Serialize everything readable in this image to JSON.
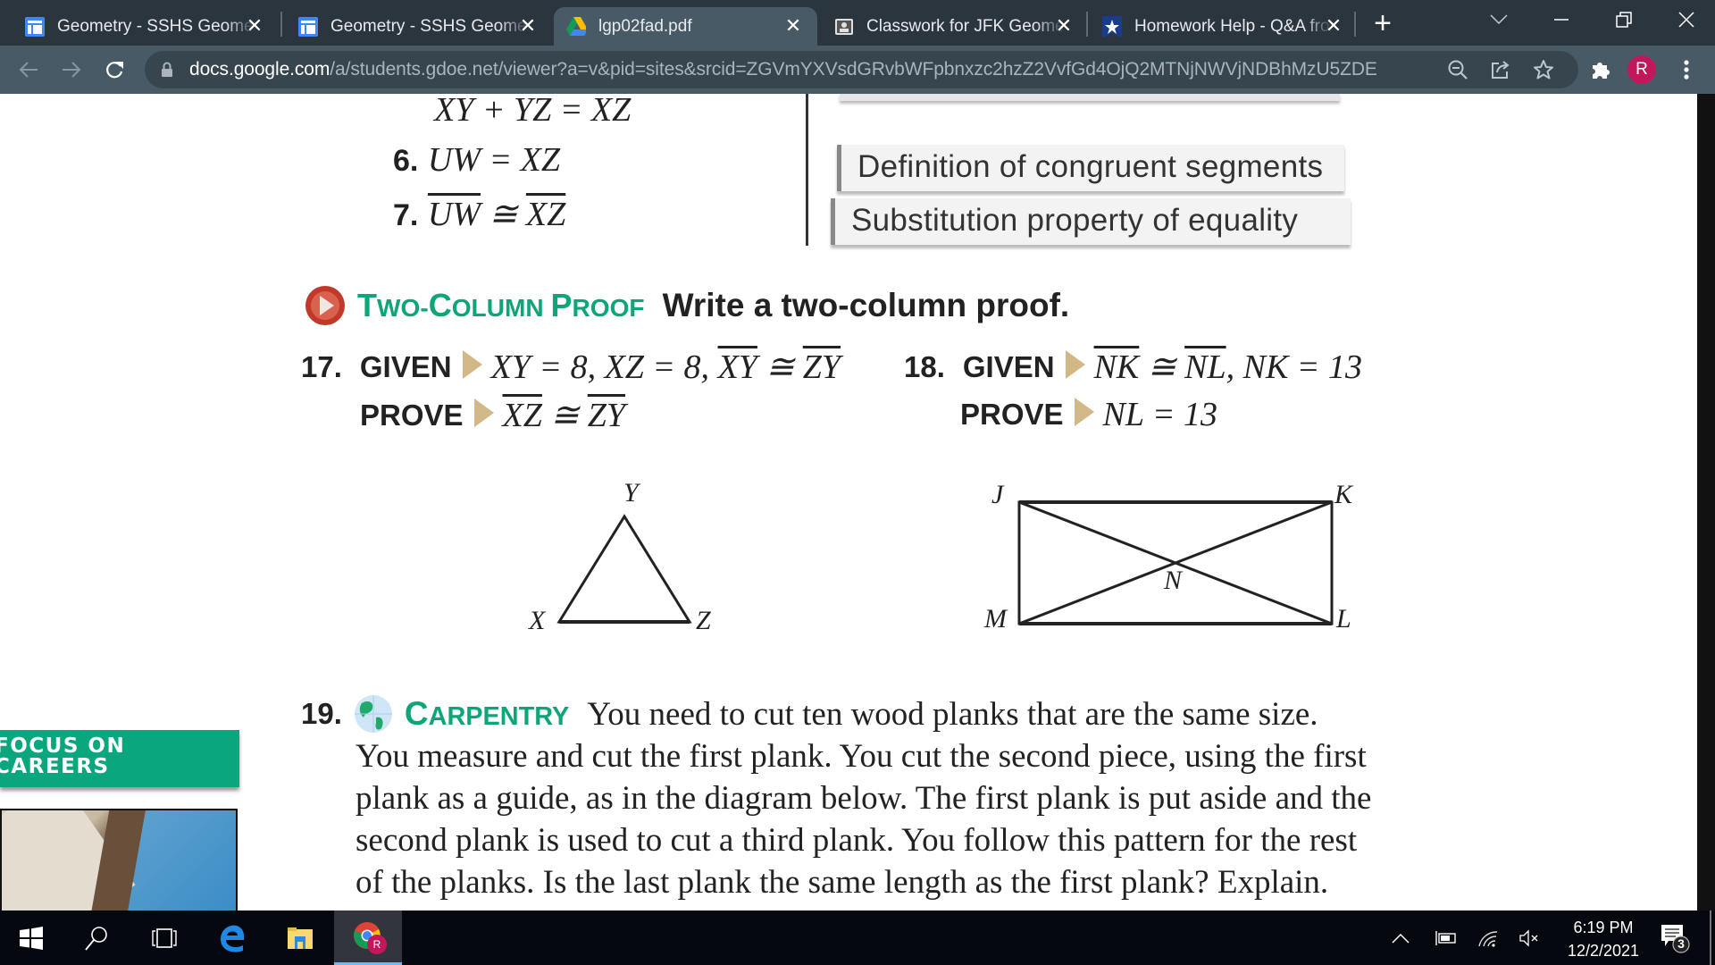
{
  "browser": {
    "tabs": [
      {
        "title": "Geometry - SSHS Geometry",
        "icon": "google-sites-icon",
        "active": false
      },
      {
        "title": "Geometry - SSHS Geometry",
        "icon": "google-sites-icon",
        "active": false
      },
      {
        "title": "lgp02fad.pdf",
        "icon": "google-drive-icon",
        "active": true
      },
      {
        "title": "Classwork for JFK Geometry",
        "icon": "classroom-icon",
        "active": false
      },
      {
        "title": "Homework Help - Q&A from",
        "icon": "homework-star-icon",
        "active": false
      }
    ],
    "close_glyph": "✕",
    "new_tab_glyph": "+",
    "url_host": "docs.google.com",
    "url_path": "/a/students.gdoe.net/viewer?a=v&pid=sites&srcid=ZGVmYXVsdGRvbWFpbnxzc2hzZ2VvfGd4OjQ2MTNjNWVjNDBhMzU5ZDE",
    "profile_initial": "R",
    "profile_color": "#c2185b"
  },
  "document": {
    "proof_tail": {
      "line5_cont": "XY + YZ = XZ",
      "steps": [
        {
          "num": "6.",
          "statement": "UW = XZ",
          "reason": "Definition of congruent segments"
        },
        {
          "num": "7.",
          "statement_left": "UW",
          "op": " ≅ ",
          "statement_right": "XZ",
          "reason": "Substitution property of equality"
        }
      ]
    },
    "section": {
      "heading_first": "T",
      "heading_rest1": "WO-",
      "heading_c": "C",
      "heading_rest2": "OLUMN ",
      "heading_p": "P",
      "heading_rest3": "ROOF",
      "instruction": "Write a two-column proof."
    },
    "problem17": {
      "num": "17.",
      "given_label": "GIVEN",
      "given_text": "XY = 8, XZ = 8, ",
      "given_seg1": "XY",
      "given_op": " ≅ ",
      "given_seg2": "ZY",
      "prove_label": "PROVE",
      "prove_seg1": "XZ",
      "prove_op": " ≅ ",
      "prove_seg2": "ZY",
      "figure_labels": {
        "top": "Y",
        "left": "X",
        "right": "Z"
      }
    },
    "problem18": {
      "num": "18.",
      "given_label": "GIVEN",
      "given_seg1": "NK",
      "given_op": " ≅ ",
      "given_seg2": "NL",
      "given_text": ", NK = 13",
      "prove_label": "PROVE",
      "prove_text": "NL = 13",
      "figure_labels": {
        "tl": "J",
        "tr": "K",
        "bl": "M",
        "br": "L",
        "center": "N"
      }
    },
    "problem19": {
      "num": "19.",
      "heading_c": "C",
      "heading_rest": "ARPENTRY",
      "lines": [
        "You need to cut ten wood planks that are the same size.",
        "You measure and cut the first plank. You cut the second piece, using the first",
        "plank as a guide, as in the diagram below. The first plank is put aside and the",
        "second plank is used to cut a third plank. You follow this pattern for the rest",
        "of the planks. Is the last plank the same length as the first plank? Explain."
      ]
    },
    "sidebar": {
      "focus_line1": "FOCUS ON",
      "focus_line2": "CAREERS"
    }
  },
  "taskbar": {
    "time": "6:19 PM",
    "date": "12/2/2021",
    "notification_count": "3",
    "chrome_badge": "R"
  }
}
